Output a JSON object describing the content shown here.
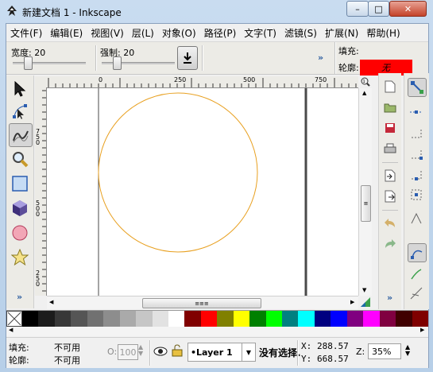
{
  "window": {
    "title": "新建文档 1 - Inkscape",
    "buttons": {
      "minimize": "–",
      "maximize": "□",
      "close": "✕"
    }
  },
  "menu": [
    {
      "label": "文件(F)",
      "name": "menu-file"
    },
    {
      "label": "编辑(E)",
      "name": "menu-edit"
    },
    {
      "label": "视图(V)",
      "name": "menu-view"
    },
    {
      "label": "层(L)",
      "name": "menu-layer"
    },
    {
      "label": "对象(O)",
      "name": "menu-object"
    },
    {
      "label": "路径(P)",
      "name": "menu-path"
    },
    {
      "label": "文字(T)",
      "name": "menu-text"
    },
    {
      "label": "滤镜(S)",
      "name": "menu-filters"
    },
    {
      "label": "扩展(N)",
      "name": "menu-extensions"
    },
    {
      "label": "帮助(H)",
      "name": "menu-help"
    }
  ],
  "tool_controls": {
    "width_label": "宽度: 20",
    "width_value": 20,
    "force_label": "强制: 20",
    "force_value": 20,
    "more": "»",
    "fill_label": "填充:",
    "fill_color": "#ff0000",
    "stroke_label": "轮廓:",
    "stroke_value": "无"
  },
  "tools": [
    {
      "name": "selector-tool-icon",
      "active": false
    },
    {
      "name": "node-tool-icon",
      "active": false
    },
    {
      "name": "tweak-tool-icon",
      "active": true
    },
    {
      "name": "zoom-tool-icon",
      "active": false
    },
    {
      "name": "rect-tool-icon",
      "active": false
    },
    {
      "name": "3dbox-tool-icon",
      "active": false
    },
    {
      "name": "circle-tool-icon",
      "active": false
    },
    {
      "name": "star-tool-icon",
      "active": false
    }
  ],
  "tools_more": "»",
  "ruler": {
    "h_ticks": [
      "0",
      "250",
      "500",
      "750"
    ],
    "v_ticks": [
      "750",
      "500",
      "250"
    ]
  },
  "canvas": {
    "circle_stroke": "#e8a020"
  },
  "scroll": {
    "h_thumb_glyph": "≡≡≡",
    "v_thumb_glyph": "≡"
  },
  "cmdbar_more": "»",
  "snapbar_more": "»",
  "palette": [
    "#000000",
    "#1c1c1c",
    "#383838",
    "#555555",
    "#717171",
    "#8d8d8d",
    "#aaaaaa",
    "#c6c6c6",
    "#e2e2e2",
    "#ffffff",
    "#800000",
    "#ff0000",
    "#808000",
    "#ffff00",
    "#008000",
    "#00ff00",
    "#008080",
    "#00ffff",
    "#000080",
    "#0000ff",
    "#800080",
    "#ff00ff",
    "#800040",
    "#400000",
    "#7f0000"
  ],
  "status": {
    "fill_label": "填充:",
    "fill_value": "不可用",
    "stroke_label": "轮廓:",
    "stroke_value": "不可用",
    "opacity_label": "O:",
    "opacity_value": "100",
    "layer": "•Layer 1",
    "message": "没有选择.",
    "x_label": "X:",
    "x_value": "288.57",
    "y_label": "Y:",
    "y_value": "668.57",
    "zoom_label": "Z:",
    "zoom_value": "35%"
  }
}
